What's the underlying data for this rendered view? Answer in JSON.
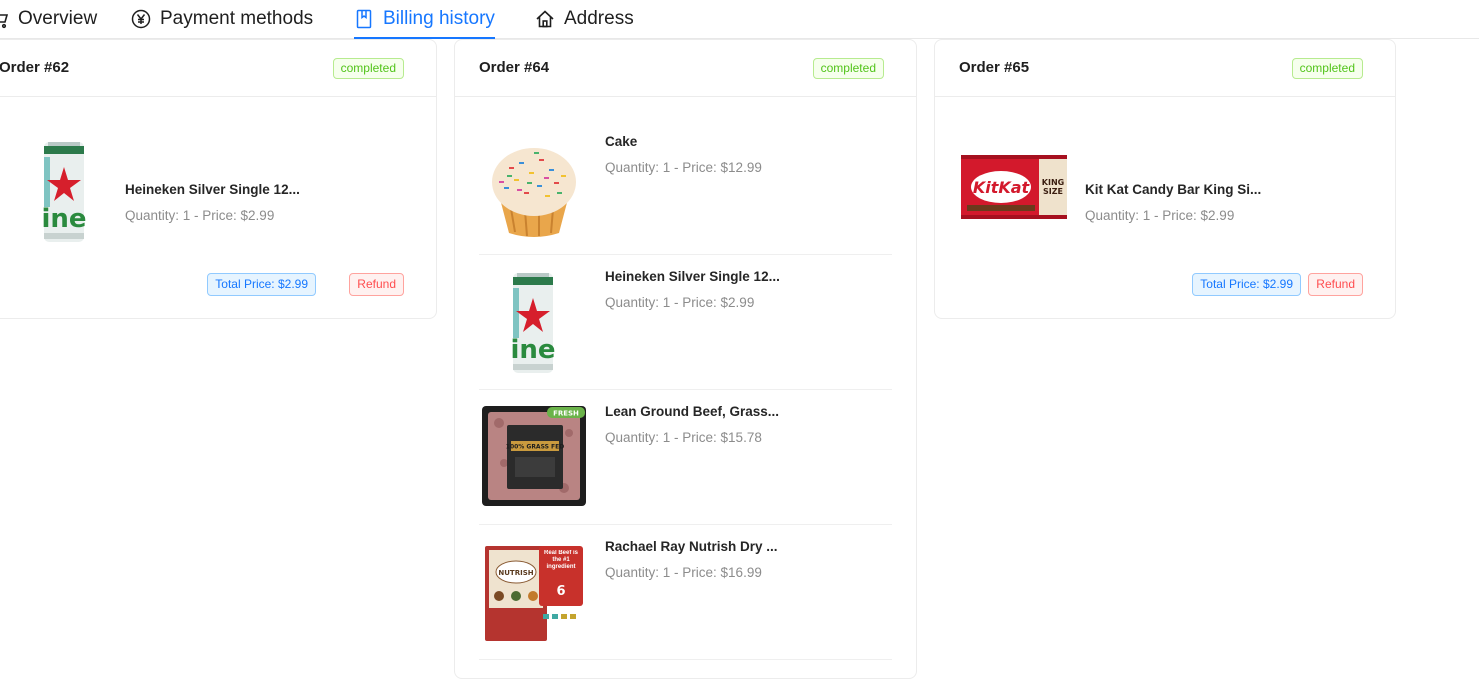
{
  "tabs": [
    {
      "label": "Overview",
      "icon": "cart-icon"
    },
    {
      "label": "Payment methods",
      "icon": "yen-circle-icon"
    },
    {
      "label": "Billing history",
      "icon": "book-icon",
      "active": true
    },
    {
      "label": "Address",
      "icon": "home-icon"
    }
  ],
  "orders": [
    {
      "title": "Order #62",
      "status": "completed",
      "items": [
        {
          "name": "Heineken Silver Single 12...",
          "meta": "Quantity: 1 - Price: $2.99",
          "image": "beer-can"
        }
      ],
      "total_label": "Total Price: $2.99",
      "refund_label": "Refund"
    },
    {
      "title": "Order #64",
      "status": "completed",
      "items": [
        {
          "name": "Cake",
          "meta": "Quantity: 1 - Price: $12.99",
          "image": "cupcake"
        },
        {
          "name": "Heineken Silver Single 12...",
          "meta": "Quantity: 1 - Price: $2.99",
          "image": "beer-can"
        },
        {
          "name": "Lean Ground Beef, Grass...",
          "meta": "Quantity: 1 - Price: $15.78",
          "image": "ground-beef"
        },
        {
          "name": "Rachael Ray Nutrish Dry ...",
          "meta": "Quantity: 1 - Price: $16.99",
          "image": "dog-food-bag"
        }
      ]
    },
    {
      "title": "Order #65",
      "status": "completed",
      "items": [
        {
          "name": "Kit Kat Candy Bar King Si...",
          "meta": "Quantity: 1 - Price: $2.99",
          "image": "candy-bar"
        }
      ],
      "total_label": "Total Price: $2.99",
      "refund_label": "Refund"
    }
  ],
  "image_labels": {
    "fresh": "FRESH",
    "kitkat": "KitKat",
    "king_size": "KING SIZE",
    "real_beef": "Real Beef is the #1 ingredient",
    "nutrish": "NUTRISH"
  },
  "colors": {
    "accent": "#1677ff",
    "success": "#52c41a",
    "danger": "#ff4d4f"
  }
}
